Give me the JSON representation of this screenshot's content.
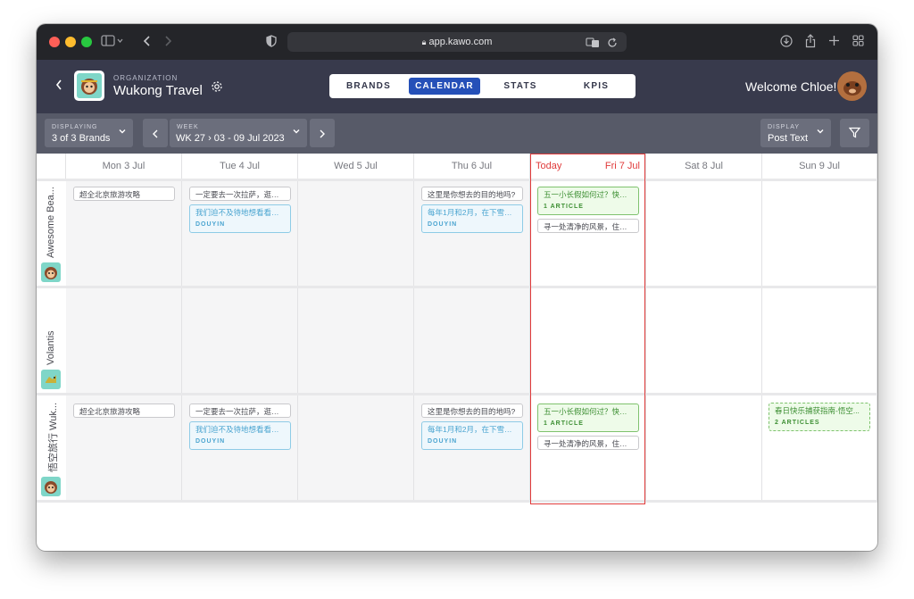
{
  "browser": {
    "url": "app.kawo.com"
  },
  "header": {
    "org_label": "ORGANIZATION",
    "org_name": "Wukong Travel",
    "tabs": [
      {
        "label": "BRANDS",
        "active": false
      },
      {
        "label": "CALENDAR",
        "active": true
      },
      {
        "label": "STATS",
        "active": false
      },
      {
        "label": "KPIS",
        "active": false
      }
    ],
    "welcome": "Welcome Chloe!"
  },
  "filters": {
    "displaying_label": "DISPLAYING",
    "displaying_value": "3 of 3 Brands",
    "week_label": "WEEK",
    "week_value": "WK 27 › 03 - 09 Jul 2023",
    "display_label": "DISPLAY",
    "display_value": "Post Text"
  },
  "calendar": {
    "today_label": "Today",
    "days": [
      "Mon 3 Jul",
      "Tue 4 Jul",
      "Wed 5 Jul",
      "Thu 6 Jul",
      "Fri 7 Jul",
      "Sat 8 Jul",
      "Sun 9 Jul"
    ],
    "rows": [
      {
        "brand": "Awesome Bea...",
        "posts": {
          "mon": [
            {
              "text": "超全北京旅游攻略"
            }
          ],
          "tue": [
            {
              "text": "一定要去一次拉萨，逛一..."
            },
            {
              "text": "我们迫不及待地想看看会...",
              "tag": "DOUYIN"
            }
          ],
          "thu": [
            {
              "text": "这里是你想去的目的地吗?"
            },
            {
              "text": "每年1月和2月，在下雪的...",
              "tag": "DOUYIN"
            }
          ],
          "fri": [
            {
              "text": "五一小长假如何过？快来...",
              "tag": "1 ARTICLE"
            },
            {
              "text": "寻一处清净的风景，住进..."
            }
          ]
        }
      },
      {
        "brand": "Volantis",
        "posts": {}
      },
      {
        "brand": "悟空旅行 Wuk...",
        "posts": {
          "mon": [
            {
              "text": "超全北京旅游攻略"
            }
          ],
          "tue": [
            {
              "text": "一定要去一次拉萨，逛一..."
            },
            {
              "text": "我们迫不及待地想看看会...",
              "tag": "DOUYIN"
            }
          ],
          "thu": [
            {
              "text": "这里是你想去的目的地吗?"
            },
            {
              "text": "每年1月和2月，在下雪的...",
              "tag": "DOUYIN"
            }
          ],
          "fri": [
            {
              "text": "五一小长假如何过？快来...",
              "tag": "1 ARTICLE"
            },
            {
              "text": "寻一处清净的风景，住进..."
            }
          ],
          "sun": [
            {
              "text": "春日快乐捕获指南-悟空...",
              "tag": "2 ARTICLES"
            }
          ]
        }
      }
    ]
  },
  "colors": {
    "accent": "#2550b8",
    "header_bg": "#383a4c",
    "filter_bg": "#575a68",
    "today": "#e03a3a",
    "douyin": "#4aa4d0",
    "article": "#3d8f33"
  }
}
